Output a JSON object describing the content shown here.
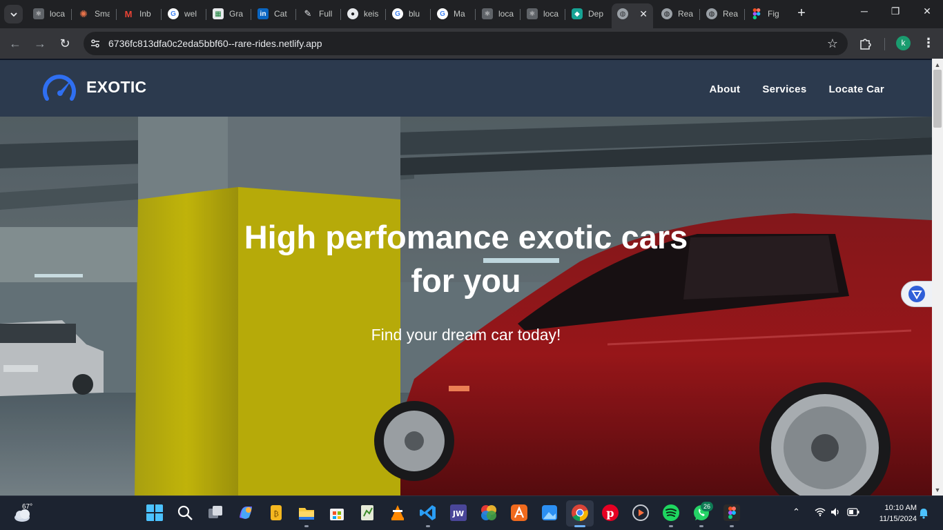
{
  "browser": {
    "tabs": [
      {
        "title": "loca",
        "icon": "react-icon"
      },
      {
        "title": "Sma",
        "icon": "spark-icon"
      },
      {
        "title": "Inb",
        "icon": "gmail-icon"
      },
      {
        "title": "wel",
        "icon": "google-icon"
      },
      {
        "title": "Gra",
        "icon": "sheet-icon"
      },
      {
        "title": "Cat",
        "icon": "linkedin-icon"
      },
      {
        "title": "Full",
        "icon": "pen-icon"
      },
      {
        "title": "keis",
        "icon": "github-icon"
      },
      {
        "title": "blu",
        "icon": "google-icon"
      },
      {
        "title": "Ma",
        "icon": "google-icon"
      },
      {
        "title": "loca",
        "icon": "react-icon"
      },
      {
        "title": "loca",
        "icon": "react-icon"
      },
      {
        "title": "Dep",
        "icon": "netlify-icon"
      },
      {
        "title": "",
        "icon": "globe-icon",
        "active": true
      },
      {
        "title": "Rea",
        "icon": "globe-icon"
      },
      {
        "title": "Rea",
        "icon": "globe-icon"
      },
      {
        "title": "Fig",
        "icon": "figma-icon"
      }
    ],
    "url": "6736fc813dfa0c2eda5bbf60--rare-rides.netlify.app",
    "profile_initial": "k"
  },
  "site": {
    "brand": "EXOTIC",
    "nav": [
      "About",
      "Services",
      "Locate Car"
    ],
    "hero": {
      "title": "High perfomance exotic cars for you",
      "subtitle": "Find your dream car today!"
    },
    "colors": {
      "header_bg": "#2c3a4e",
      "logo_blue": "#2f6ff2"
    }
  },
  "taskbar": {
    "weather_temp": "67°",
    "whatsapp_badge": "26",
    "time": "10:10 AM",
    "date": "11/15/2024"
  }
}
